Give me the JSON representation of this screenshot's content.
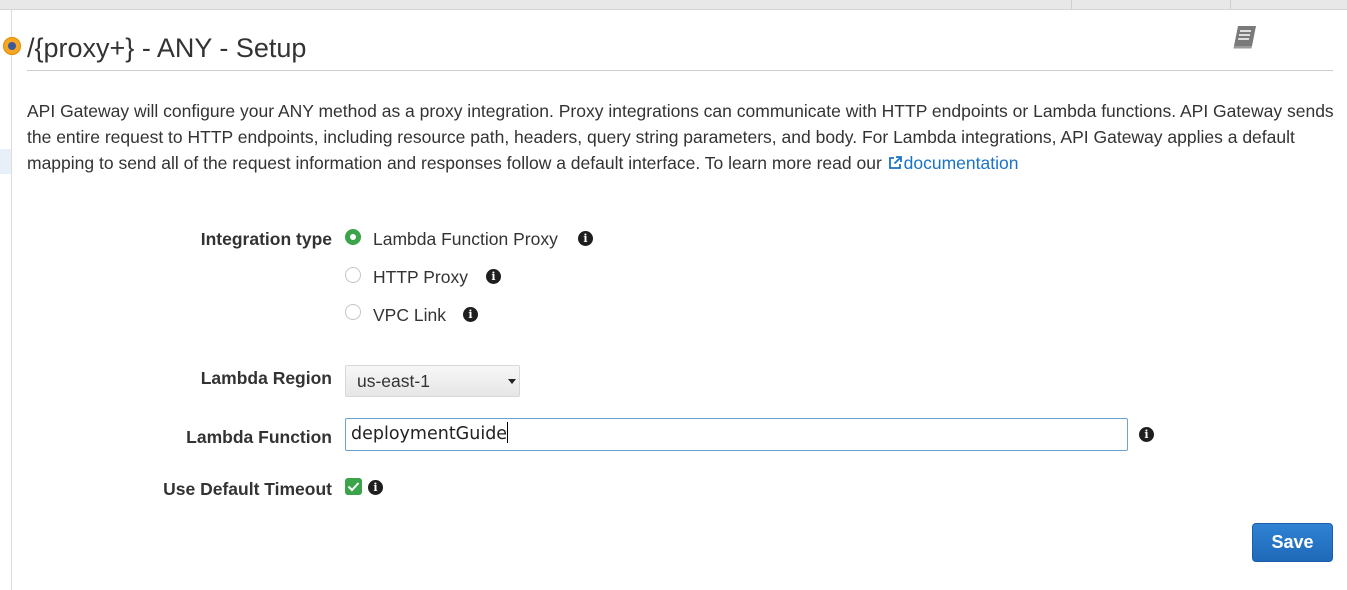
{
  "header": {
    "title": "/{proxy+} - ANY - Setup",
    "book_icon": "book-icon"
  },
  "description": {
    "text": "API Gateway will configure your ANY method as a proxy integration. Proxy integrations can communicate with HTTP endpoints or Lambda functions. API Gateway sends the entire request to HTTP endpoints, including resource path, headers, query string parameters, and body. For Lambda integrations, API Gateway applies a default mapping to send all of the request information and responses follow a default interface. To learn more read our ",
    "link_label": "documentation",
    "link_icon": "external-link-icon"
  },
  "integration": {
    "label": "Integration type",
    "selected": "Lambda Function Proxy",
    "options": [
      {
        "label": "Lambda Function Proxy",
        "checked": true
      },
      {
        "label": "HTTP Proxy",
        "checked": false
      },
      {
        "label": "VPC Link",
        "checked": false
      }
    ]
  },
  "region": {
    "label": "Lambda Region",
    "value": "us-east-1"
  },
  "function": {
    "label": "Lambda Function",
    "value": "deploymentGuide"
  },
  "timeout": {
    "label": "Use Default Timeout",
    "checked": true
  },
  "actions": {
    "save_label": "Save"
  },
  "colors": {
    "accent": "#1f69b8",
    "success": "#3ba34a",
    "status_dot": "#f5a623",
    "link": "#1a73c8"
  }
}
